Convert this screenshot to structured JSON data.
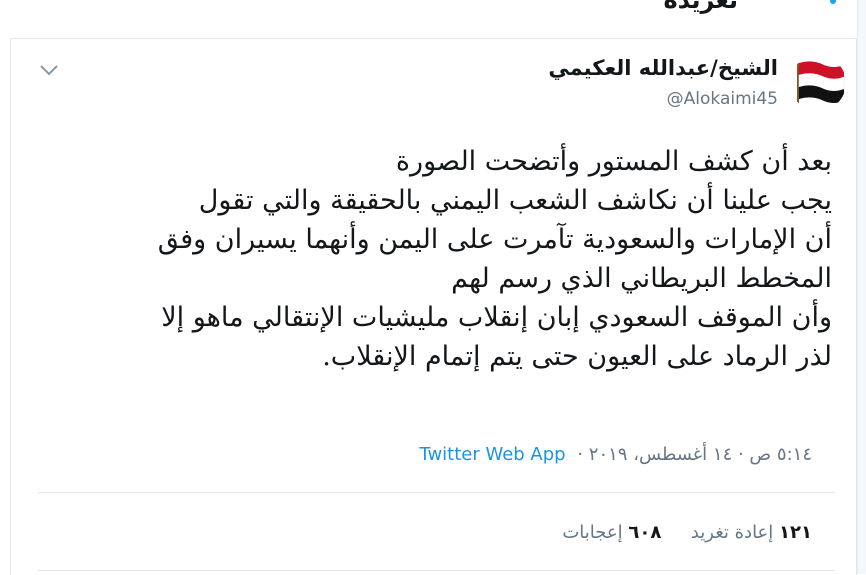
{
  "header": {
    "title": "تغريدة"
  },
  "tweet": {
    "author_name": "الشيخ/عبدالله العكيمي",
    "author_handle": "@Alokaimi45",
    "lines": [
      "بعد أن كشف المستور وأتضحت الصورة",
      "يجب علينا أن نكاشف الشعب اليمني بالحقيقة والتي تقول",
      "أن الإمارات والسعودية تآمرت على اليمن وأنهما يسيران وفق",
      "المخطط البريطاني الذي رسم لهم",
      "وأن الموقف السعودي إبان إنقلاب مليشيات الإنتقالي ماهو إلا",
      "لذر الرماد على العيون حتى يتم إتمام الإنقلاب."
    ],
    "timestamp": "٥:١٤ ص · ١٤ أغسطس، ٢٠١٩ ·",
    "source_app": "Twitter Web App"
  },
  "stats": {
    "retweets_count": "١٢١",
    "retweets_label": "إعادة تغريد",
    "likes_count": "٦٠٨",
    "likes_label": "إعجابات"
  },
  "icons": {
    "menu": "chevron-down-icon",
    "avatar": "yemen-flag-avatar"
  },
  "colors": {
    "link": "#1b95e0",
    "muted": "#657786",
    "border": "#e1e8ed"
  }
}
